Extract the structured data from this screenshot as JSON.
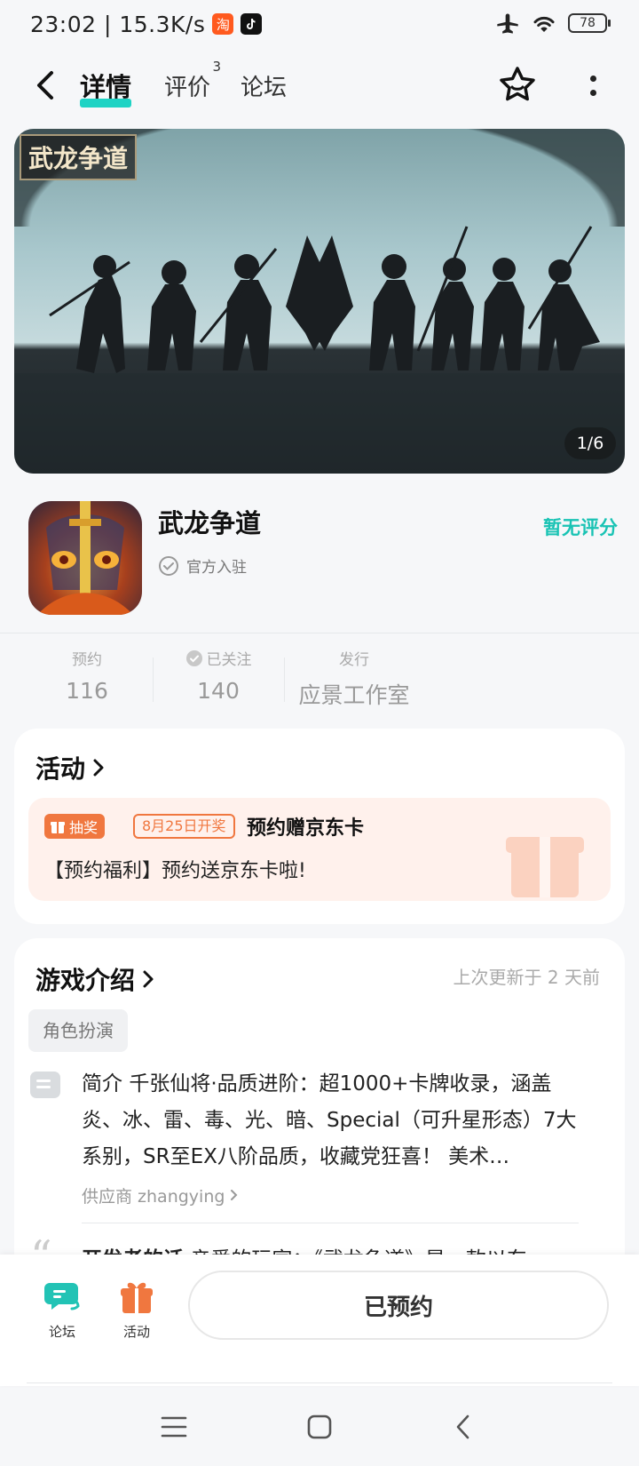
{
  "status_bar": {
    "time_speed": "23:02 | 15.3K/s",
    "taobao_app_icon_glyph": "淘",
    "battery": "78"
  },
  "header": {
    "tabs": [
      {
        "label": "详情",
        "active": true
      },
      {
        "label": "评价",
        "badge": "3"
      },
      {
        "label": "论坛"
      }
    ]
  },
  "banner": {
    "logo_text": "武龙争道",
    "counter": "1/6"
  },
  "app": {
    "name": "武龙争道",
    "official": "官方入驻",
    "rating": "暂无评分"
  },
  "stats": [
    {
      "label": "预约",
      "value": "116"
    },
    {
      "label": "已关注",
      "value": "140"
    },
    {
      "label": "发行",
      "value": "应景工作室"
    }
  ],
  "activity": {
    "title": "活动",
    "tag": "抽奖",
    "date_tag": "8月25日开奖",
    "item_title": "预约赠京东卡",
    "item_desc": "【预约福利】预约送京东卡啦!"
  },
  "intro": {
    "title": "游戏介绍",
    "updated": "上次更新于 2 天前",
    "genre": "角色扮演",
    "summary_label": "简介",
    "summary": "千张仙将·品质进阶：超1000+卡牌收录，涵盖炎、冰、雷、毒、光、暗、Special（可升星形态）7大系别，SR至EX八阶品质，收藏党狂喜！ 美术…",
    "supplier": "供应商 zhangying",
    "dev_label": "开发者的话",
    "dev_text": "亲爱的玩家：《武龙争道》是一款以东"
  },
  "bottom_bar": {
    "forum_label": "论坛",
    "activity_label": "活动",
    "reserve_label": "已预约"
  },
  "colors": {
    "accent": "#1ed3c4",
    "rating": "#19c3b4",
    "activity_orange": "#f0773f",
    "forum_teal": "#22c3b5"
  }
}
